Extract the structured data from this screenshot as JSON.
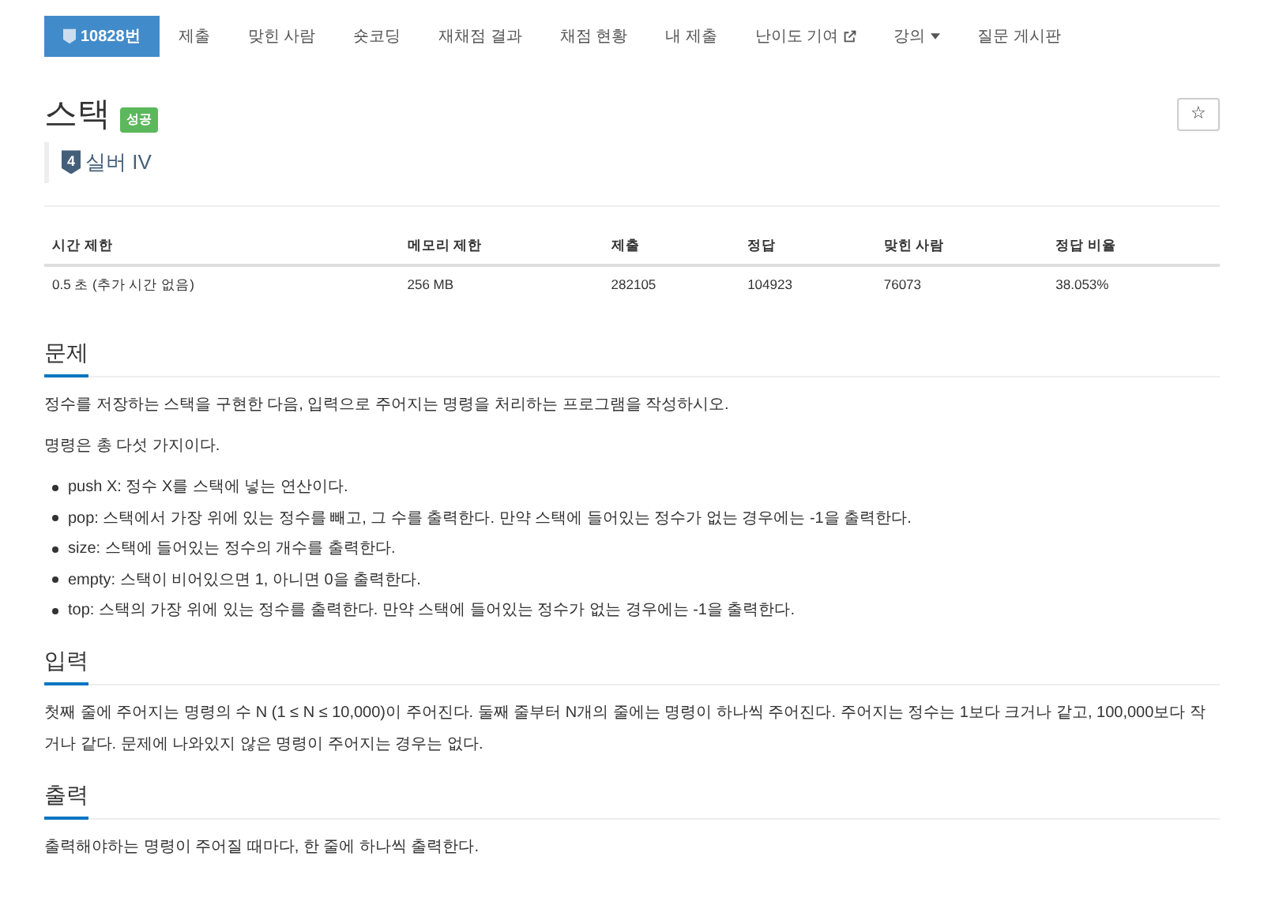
{
  "nav": [
    {
      "label": "10828번",
      "kind": "problem",
      "selected": true
    },
    {
      "label": "제출",
      "kind": "plain",
      "selected": false
    },
    {
      "label": "맞힌 사람",
      "kind": "plain",
      "selected": false
    },
    {
      "label": "숏코딩",
      "kind": "plain",
      "selected": false
    },
    {
      "label": "재채점 결과",
      "kind": "plain",
      "selected": false
    },
    {
      "label": "채점 현황",
      "kind": "plain",
      "selected": false
    },
    {
      "label": "내 제출",
      "kind": "plain",
      "selected": false
    },
    {
      "label": "난이도 기여",
      "kind": "external",
      "selected": false
    },
    {
      "label": "강의",
      "kind": "dropdown",
      "selected": false
    },
    {
      "label": "질문 게시판",
      "kind": "plain",
      "selected": false
    }
  ],
  "title": "스택",
  "status_badge": "성공",
  "star_button": "☆",
  "tier": {
    "number": "4",
    "label": "실버 IV"
  },
  "table": {
    "columns": [
      "시간 제한",
      "메모리 제한",
      "제출",
      "정답",
      "맞힌 사람",
      "정답 비율"
    ],
    "rows": [
      [
        "0.5 초 (추가 시간 없음)",
        "256 MB",
        "282105",
        "104923",
        "76073",
        "38.053%"
      ]
    ]
  },
  "sections": [
    {
      "heading": "문제",
      "paragraphs": [
        "정수를 저장하는 스택을 구현한 다음, 입력으로 주어지는 명령을 처리하는 프로그램을 작성하시오.",
        "명령은 총 다섯 가지이다."
      ],
      "bullets": [
        "push X: 정수 X를 스택에 넣는 연산이다.",
        "pop: 스택에서 가장 위에 있는 정수를 빼고, 그 수를 출력한다. 만약 스택에 들어있는 정수가 없는 경우에는 -1을 출력한다.",
        "size: 스택에 들어있는 정수의 개수를 출력한다.",
        "empty: 스택이 비어있으면 1, 아니면 0을 출력한다.",
        "top: 스택의 가장 위에 있는 정수를 출력한다. 만약 스택에 들어있는 정수가 없는 경우에는 -1을 출력한다."
      ]
    },
    {
      "heading": "입력",
      "paragraphs": [
        "첫째 줄에 주어지는 명령의 수 N (1 ≤ N ≤ 10,000)이 주어진다. 둘째 줄부터 N개의 줄에는 명령이 하나씩 주어진다. 주어지는 정수는 1보다 크거나 같고, 100,000보다 작거나 같다. 문제에 나와있지 않은 명령이 주어지는 경우는 없다."
      ]
    },
    {
      "heading": "출력",
      "paragraphs": [
        "출력해야하는 명령이 주어질 때마다, 한 줄에 하나씩 출력한다."
      ]
    }
  ]
}
